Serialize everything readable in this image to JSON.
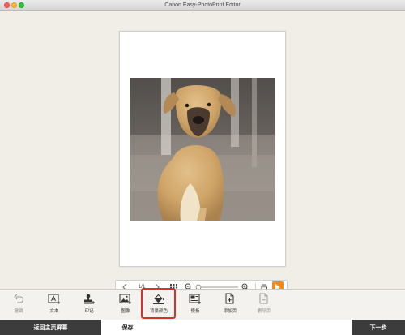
{
  "window": {
    "title": "Canon Easy-PhotoPrint Editor"
  },
  "zoom_bar": {
    "page_indicator": "1/1"
  },
  "toolbar": {
    "items": [
      {
        "label": "撤销",
        "icon": "undo-icon",
        "enabled": false
      },
      {
        "label": "文本",
        "icon": "text-box-icon",
        "enabled": true
      },
      {
        "label": "印记",
        "icon": "stamp-icon",
        "enabled": true
      },
      {
        "label": "图像",
        "icon": "add-image-icon",
        "enabled": true
      },
      {
        "label": "背景颜色",
        "icon": "background-color-icon",
        "enabled": true,
        "highlighted": true
      },
      {
        "label": "模板",
        "icon": "template-icon",
        "enabled": true
      },
      {
        "label": "添加页",
        "icon": "add-page-icon",
        "enabled": true
      },
      {
        "label": "删除页",
        "icon": "delete-page-icon",
        "enabled": false
      }
    ]
  },
  "bottom_bar": {
    "home_label": "返回主页屏幕",
    "save_label": "保存",
    "next_label": "下一步"
  },
  "colors": {
    "accent": "#f08a1c",
    "highlight": "#d8302a",
    "dark_button": "#3c3c3c"
  }
}
